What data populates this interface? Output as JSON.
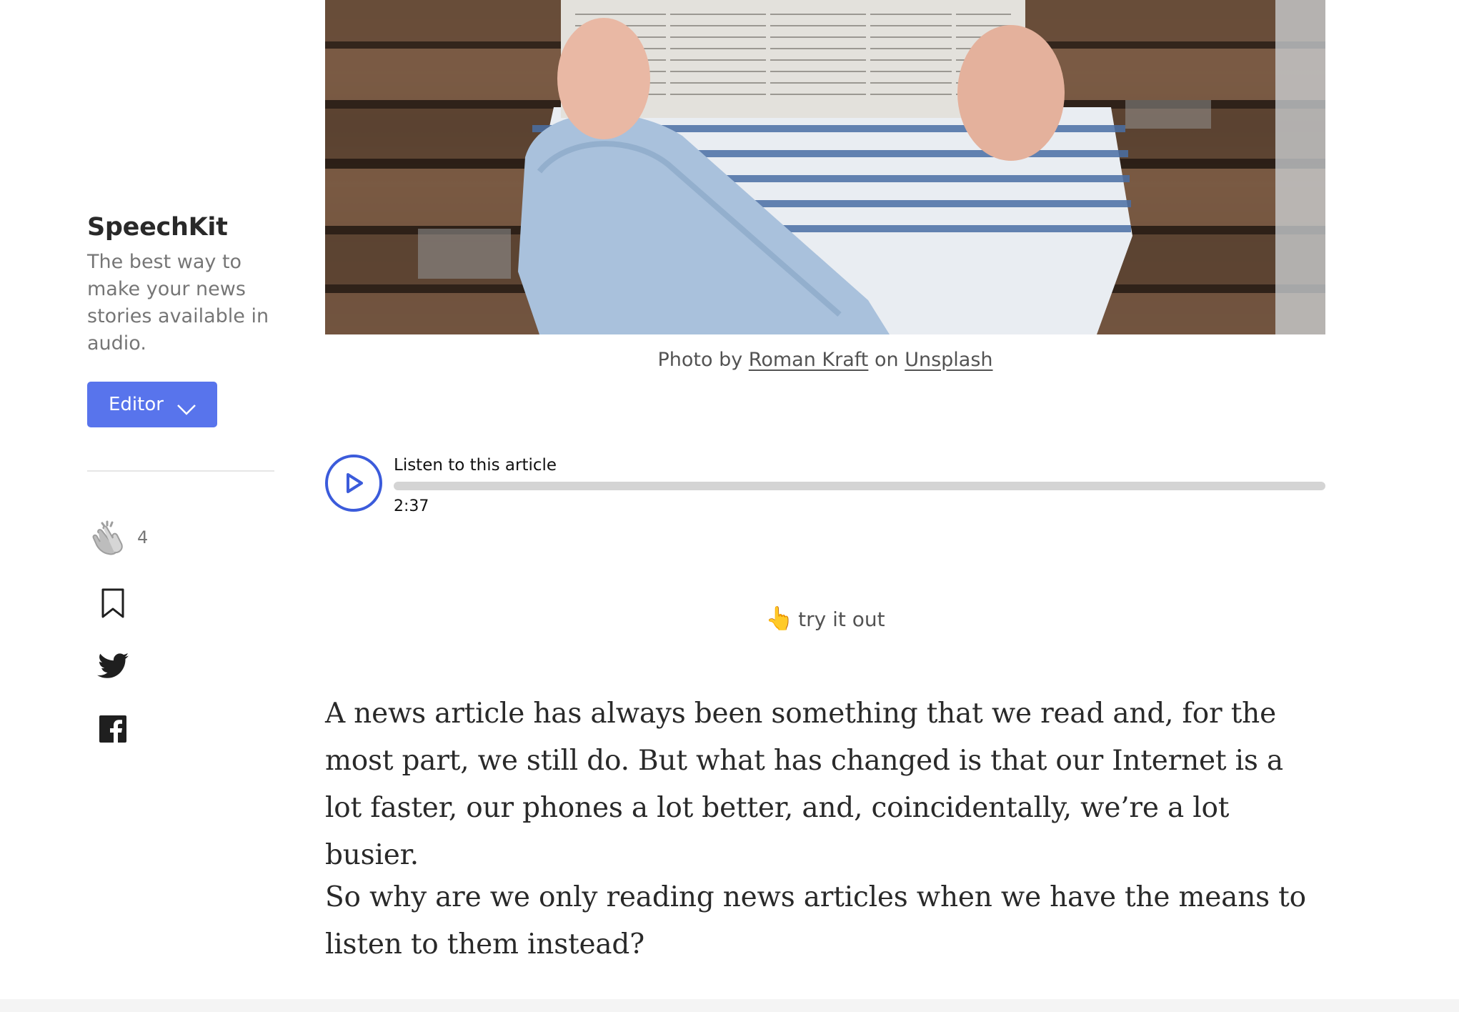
{
  "sidebar": {
    "publication_name": "SpeechKit",
    "publication_description": "The best way to make your news stories available in audio.",
    "editor_button_label": "Editor",
    "clap_count": "4"
  },
  "hero": {
    "caption_prefix": "Photo by",
    "caption_author": "Roman Kraft",
    "caption_on": "on",
    "caption_source": "Unsplash"
  },
  "player": {
    "title": "Listen to this article",
    "duration": "2:37",
    "progress_fraction": 0,
    "accent_color": "#3b5bdb"
  },
  "hint": {
    "emoji": "👆",
    "text": "try it out"
  },
  "article": {
    "paragraphs": [
      "A news article has always been something that we read and, for the most part, we still do. But what has changed is that our Internet is a lot faster, our phones a lot better, and, coincidentally, we’re a lot busier.",
      "So why are we only reading news articles when we have the means to listen to them instead?"
    ]
  },
  "colors": {
    "editor_button": "#5874ec",
    "text": "#1f1f1f",
    "muted_text": "#757575"
  }
}
